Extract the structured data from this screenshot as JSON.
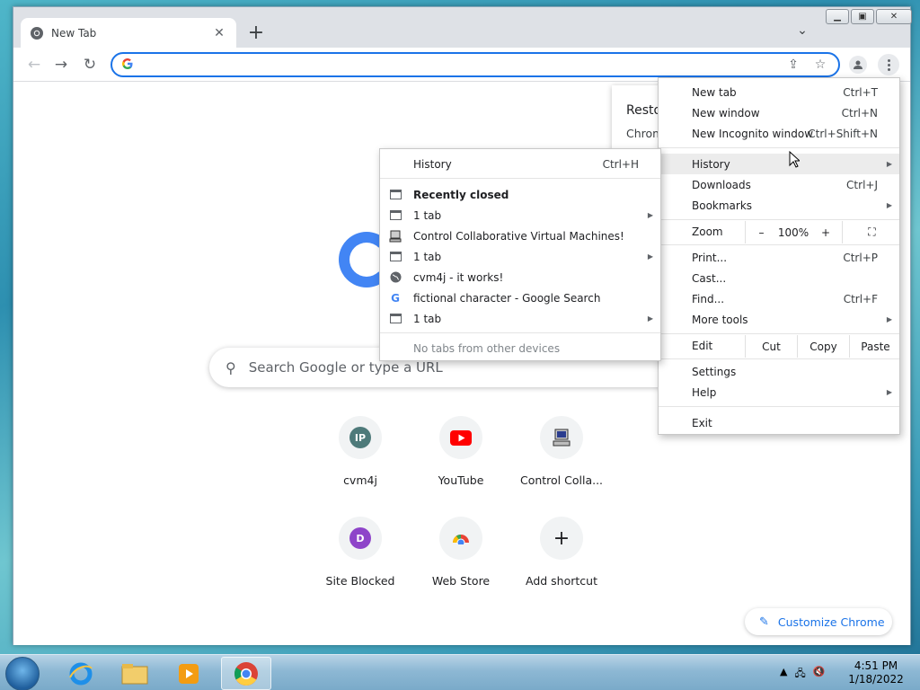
{
  "browser": {
    "tab_title": "New Tab",
    "omnibox_value": "",
    "colors": {
      "accent": "#1a73e8",
      "tabstrip": "#dee1e6"
    }
  },
  "ntp": {
    "search_placeholder": "Search Google or type a URL",
    "restore_title": "Resto",
    "restore_sub": "Chrom",
    "shortcuts": [
      {
        "label": "cvm4j",
        "icon": "IP"
      },
      {
        "label": "YouTube",
        "icon": "youtube-icon"
      },
      {
        "label": "Control Colla...",
        "icon": "computer-icon"
      },
      {
        "label": "Site Blocked",
        "icon": "D"
      },
      {
        "label": "Web Store",
        "icon": "webstore-icon"
      },
      {
        "label": "Add shortcut",
        "icon": "plus-icon"
      }
    ],
    "customize_label": "Customize Chrome"
  },
  "main_menu": {
    "new_tab": {
      "label": "New tab",
      "shortcut": "Ctrl+T"
    },
    "new_window": {
      "label": "New window",
      "shortcut": "Ctrl+N"
    },
    "incognito": {
      "label": "New Incognito window",
      "shortcut": "Ctrl+Shift+N"
    },
    "history": {
      "label": "History"
    },
    "downloads": {
      "label": "Downloads",
      "shortcut": "Ctrl+J"
    },
    "bookmarks": {
      "label": "Bookmarks"
    },
    "zoom": {
      "label": "Zoom",
      "minus": "–",
      "level": "100%",
      "plus": "+"
    },
    "print": {
      "label": "Print...",
      "shortcut": "Ctrl+P"
    },
    "cast": {
      "label": "Cast..."
    },
    "find": {
      "label": "Find...",
      "shortcut": "Ctrl+F"
    },
    "more_tools": {
      "label": "More tools"
    },
    "edit": {
      "label": "Edit",
      "cut": "Cut",
      "copy": "Copy",
      "paste": "Paste"
    },
    "settings": {
      "label": "Settings"
    },
    "help": {
      "label": "Help"
    },
    "exit": {
      "label": "Exit"
    }
  },
  "history_menu": {
    "history": {
      "label": "History",
      "shortcut": "Ctrl+H"
    },
    "recently_closed": "Recently closed",
    "items": [
      "1 tab",
      "Control Collaborative Virtual Machines!",
      "1 tab",
      "cvm4j - it works!",
      "fictional character - Google Search",
      "1 tab"
    ],
    "no_tabs": "No tabs from other devices"
  },
  "taskbar": {
    "time": "4:51 PM",
    "date": "1/18/2022"
  }
}
